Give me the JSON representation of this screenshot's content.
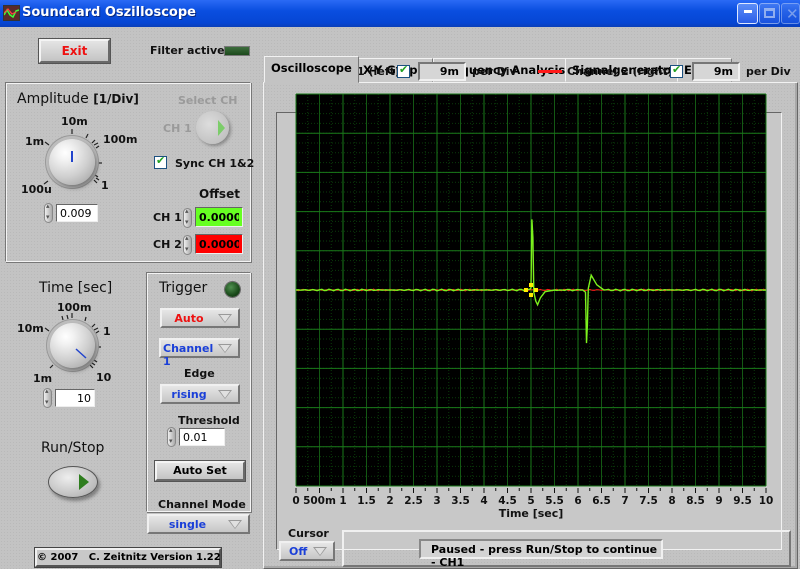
{
  "window": {
    "title": "Soundcard Oszilloscope",
    "controls": {
      "minimize": "minimize-icon",
      "maximize": "maximize-icon",
      "close": "close-icon"
    }
  },
  "left": {
    "exit_label": "Exit",
    "filter_label": "Filter active",
    "filter_active": false,
    "amplitude": {
      "title": "Amplitude",
      "unit": "[1/Div]",
      "knob_ticks": [
        "100u",
        "1m",
        "10m",
        "100m",
        "1"
      ],
      "value": "0.009"
    },
    "select_ch": {
      "title": "Select CH",
      "label": "CH 1"
    },
    "sync": {
      "label": "Sync CH 1&2",
      "checked": true
    },
    "offset": {
      "title": "Offset",
      "ch1_label": "CH 1",
      "ch1_value": "0.0000",
      "ch2_label": "CH 2",
      "ch2_value": "0.0000"
    },
    "time": {
      "title": "Time [sec]",
      "knob_ticks": [
        "1m",
        "10m",
        "100m",
        "1",
        "10"
      ],
      "value": "10"
    },
    "run_stop_label": "Run/Stop",
    "trigger": {
      "title": "Trigger",
      "mode": "Auto",
      "channel": "Channel 1",
      "edge_label": "Edge",
      "edge": "rising",
      "threshold_label": "Threshold",
      "threshold": "0.01",
      "autoset_label": "Auto Set"
    },
    "channel_mode": {
      "label": "Channel Mode",
      "value": "single"
    },
    "copyright": "© 2007   C. Zeitnitz Version 1.22"
  },
  "tabs": [
    {
      "label": "Oscilloscope",
      "active": true
    },
    {
      "label": "X-Y Graph",
      "active": false
    },
    {
      "label": "Frequency Analysis",
      "active": false
    },
    {
      "label": "Signalgenerator",
      "active": false
    },
    {
      "label": "Extras",
      "active": false
    }
  ],
  "channels": {
    "ch1": {
      "label": "Channel 1 (left)",
      "enabled": true,
      "per_div": "9m",
      "per_div_label": "per Div",
      "color": "#7cf11d"
    },
    "ch2": {
      "label": "Channel 2 (right)",
      "enabled": true,
      "per_div": "9m",
      "per_div_label": "per Div",
      "color": "#ff1a1a"
    }
  },
  "cursor": {
    "label": "Cursor",
    "value": "Off"
  },
  "status": "Paused - press Run/Stop to continue - CH1",
  "chart_data": {
    "type": "line",
    "title": "",
    "xlabel": "Time [sec]",
    "ylabel": "",
    "xlim": [
      0,
      10
    ],
    "ylim_div": [
      -5,
      5
    ],
    "volts_per_div": 0.009,
    "grid": true,
    "x_ticks": [
      "0",
      "500m",
      "1",
      "1.5",
      "2",
      "2.5",
      "3",
      "3.5",
      "4",
      "4.5",
      "5",
      "5.5",
      "6",
      "6.5",
      "7",
      "7.5",
      "8",
      "8.5",
      "9",
      "9.5",
      "10"
    ],
    "series": [
      {
        "name": "Channel 1 (left)",
        "color": "#7cf11d",
        "x": [
          0,
          4.9,
          4.98,
          5.0,
          5.02,
          5.04,
          5.06,
          5.1,
          5.14,
          5.2,
          5.3,
          5.5,
          6.1,
          6.16,
          6.18,
          6.2,
          6.22,
          6.28,
          6.4,
          6.55,
          10
        ],
        "y": [
          0,
          0,
          0.0002,
          0.0005,
          0.0162,
          0.012,
          -0.0005,
          -0.0025,
          -0.0034,
          -0.0018,
          -0.0004,
          0,
          0,
          -0.0005,
          -0.0122,
          -0.008,
          0.0004,
          0.0034,
          0.0012,
          0,
          0
        ]
      },
      {
        "name": "Channel 2 (right)",
        "color": "#ff1a1a",
        "x": [
          0,
          10
        ],
        "y": [
          0,
          0
        ]
      }
    ],
    "trigger_marker": {
      "x": 5.0,
      "y": 0,
      "color": "#ffee00"
    }
  }
}
